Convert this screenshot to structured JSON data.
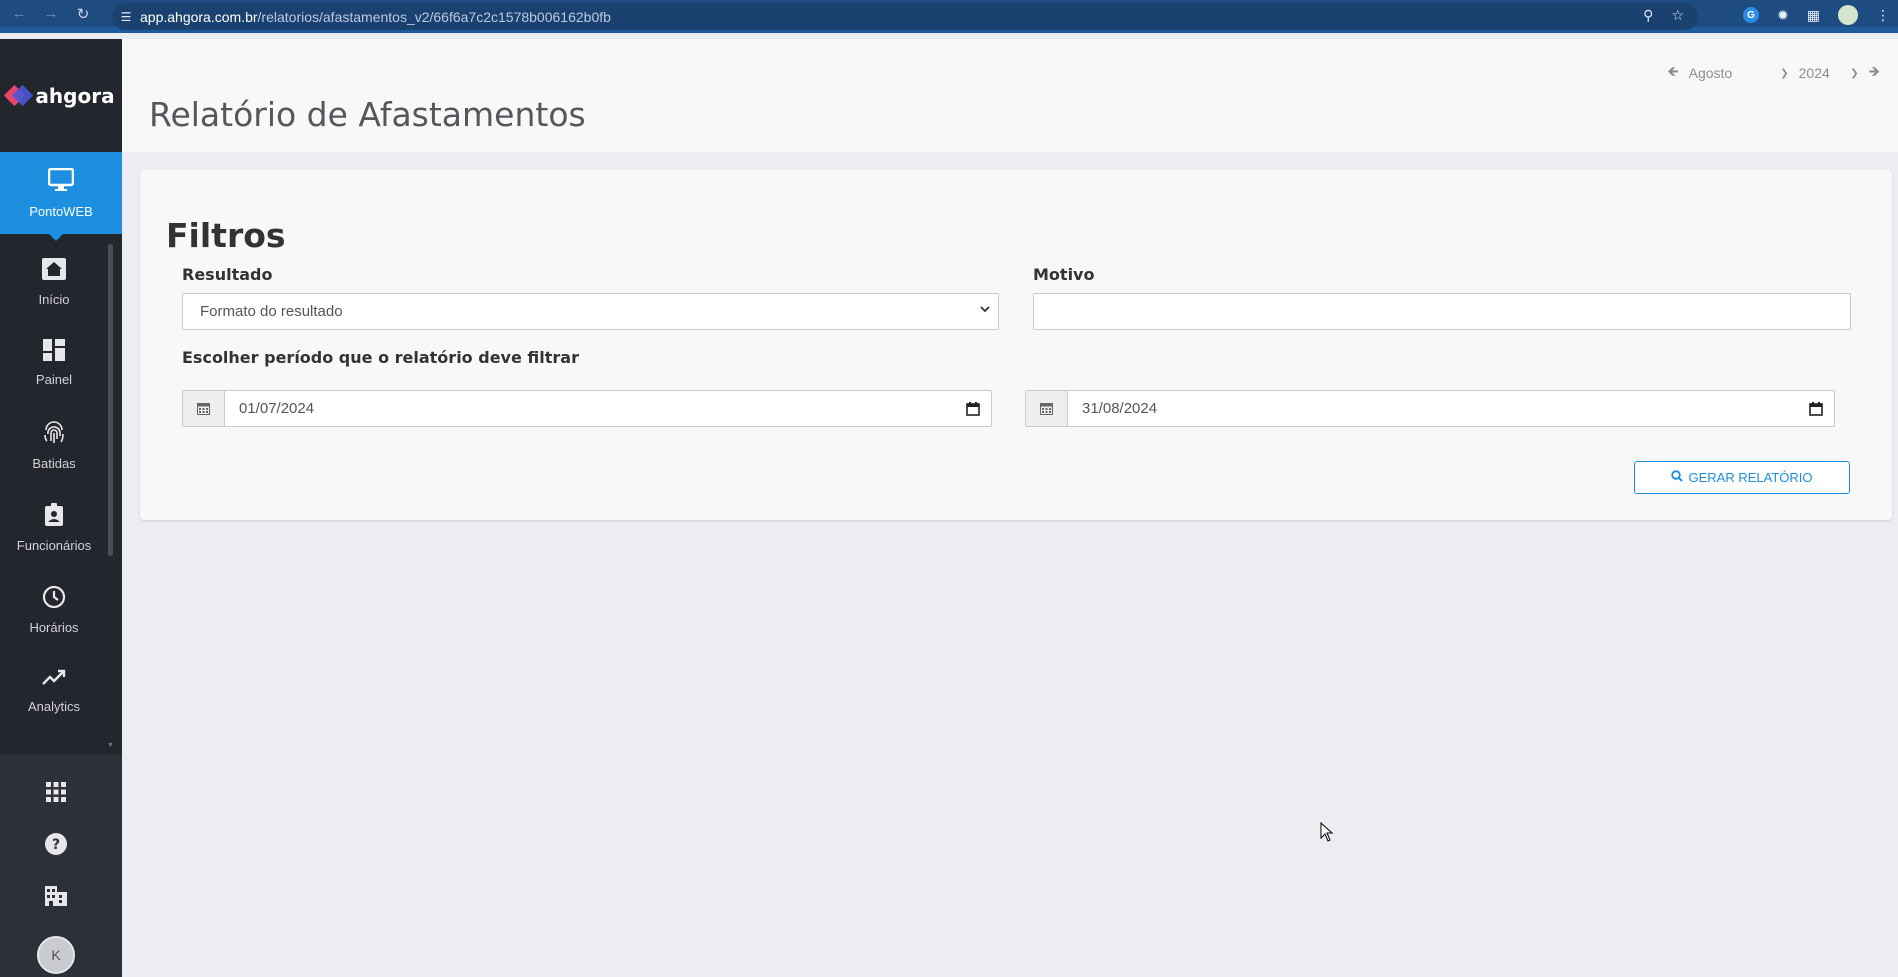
{
  "browser": {
    "url_host": "app.ahgora.com.br",
    "url_path": "/relatorios/afastamentos_v2/66f6a7c2c1578b006162b0fb"
  },
  "sidebar": {
    "brand": "ahgora",
    "active_item": {
      "label": "PontoWEB",
      "icon": "monitor-icon"
    },
    "items": [
      {
        "label": "Início",
        "icon": "home-icon"
      },
      {
        "label": "Painel",
        "icon": "dashboard-icon"
      },
      {
        "label": "Batidas",
        "icon": "fingerprint-icon"
      },
      {
        "label": "Funcionários",
        "icon": "badge-icon"
      },
      {
        "label": "Horários",
        "icon": "clock-icon"
      },
      {
        "label": "Analytics",
        "icon": "trend-icon"
      }
    ],
    "bottom_icons": [
      "apps-grid-icon",
      "help-icon",
      "building-icon"
    ],
    "user_initial": "K"
  },
  "header": {
    "title": "Relatório de Afastamentos",
    "month": "Agosto",
    "year": "2024"
  },
  "filters": {
    "title": "Filtros",
    "result_label": "Resultado",
    "result_value": "Formato do resultado",
    "reason_label": "Motivo",
    "reason_value": "",
    "period_label": "Escolher período que o relatório deve filtrar",
    "start_date": "01/07/2024",
    "end_date": "31/08/2024",
    "generate_label": "GERAR RELATÓRIO"
  },
  "colors": {
    "accent": "#1d8fe0",
    "sidebar_bg": "#23262d",
    "browser_bar": "#1e4b80"
  }
}
